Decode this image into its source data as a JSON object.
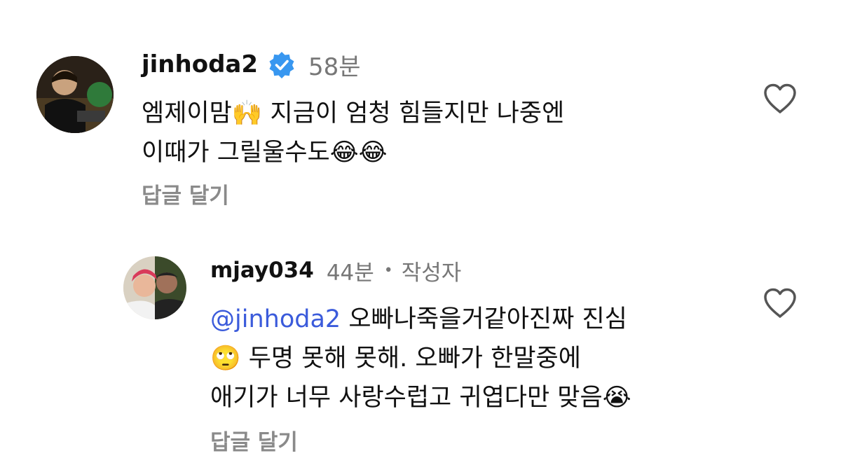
{
  "comments": [
    {
      "username": "jinhoda2",
      "verified": true,
      "time": "58분",
      "lines": [
        "엠제이맘🙌 지금이 엄청 힘들지만 나중엔",
        "이때가 그릴울수도😂😂"
      ],
      "reply_label": "답글 달기",
      "like_icon": "heart-outline-icon"
    },
    {
      "username": "mjay034",
      "time": "44분",
      "separator": "•",
      "author_label": "작성자",
      "mention": "@jinhoda2",
      "lines": [
        "오빠나죽을거같아진짜 진심",
        "🙄 두명 못해 못해. 오빠가 한말중에",
        "애기가 너무 사랑수럽고 귀엽다만 맞음😭"
      ],
      "reply_label": "답글 달기",
      "like_icon": "heart-outline-icon"
    }
  ],
  "colors": {
    "verified_badge": "#3897F0",
    "mention": "#3B5BDB",
    "secondary_text": "#777777"
  }
}
